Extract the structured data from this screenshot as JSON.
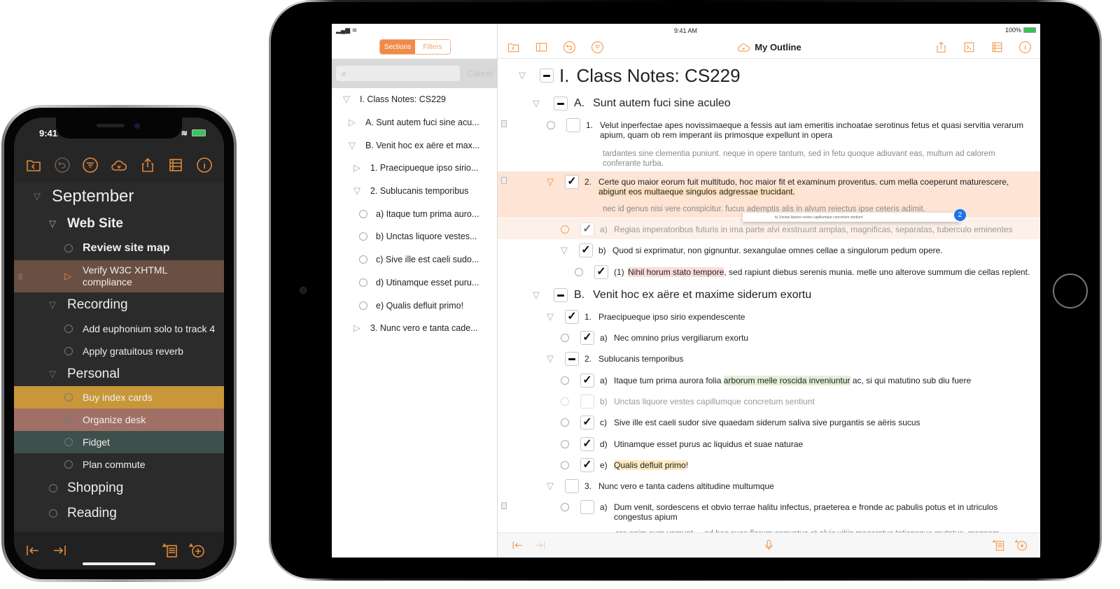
{
  "colors": {
    "accent": "#f08b47",
    "phone_bg": "#2b2b2b",
    "selected_row": "#6a4f43",
    "yellow_row": "#c9973a",
    "rose_row": "#a07066",
    "teal_row": "#3e504c"
  },
  "phone": {
    "status": {
      "time": "9:41",
      "icons": [
        "location-arrow-icon",
        "wifi-icon",
        "battery-icon"
      ]
    },
    "toolbar": [
      "folder-back-icon",
      "undo-icon",
      "filter-icon",
      "sync-cloud-icon",
      "share-icon",
      "columns-icon",
      "info-icon"
    ],
    "outline": [
      {
        "label": "September",
        "level": 0,
        "marker": "triangle-down"
      },
      {
        "label": "Web Site",
        "level": 1,
        "marker": "triangle-down",
        "bold": true
      },
      {
        "label": "Review site map",
        "level": 2,
        "marker": "circle",
        "bold": true
      },
      {
        "label": "Verify W3C XHTML compliance",
        "level": 2,
        "marker": "triangle-right",
        "selected": true
      },
      {
        "label": "Recording",
        "level": 1,
        "marker": "triangle-down"
      },
      {
        "label": "Add euphonium solo to track 4",
        "level": 2,
        "marker": "circle"
      },
      {
        "label": "Apply gratuitous reverb",
        "level": 2,
        "marker": "circle"
      },
      {
        "label": "Personal",
        "level": 1,
        "marker": "triangle-down"
      },
      {
        "label": "Buy index cards",
        "level": 2,
        "marker": "circle",
        "color": "yellow"
      },
      {
        "label": "Organize desk",
        "level": 2,
        "marker": "circle",
        "color": "rose"
      },
      {
        "label": "Fidget",
        "level": 2,
        "marker": "circle",
        "color": "teal"
      },
      {
        "label": "Plan commute",
        "level": 2,
        "marker": "circle"
      },
      {
        "label": "Shopping",
        "level": 1,
        "marker": "circle"
      },
      {
        "label": "Reading",
        "level": 1,
        "marker": "circle"
      }
    ],
    "bottom": [
      "outdent-icon",
      "indent-icon",
      "add-note-icon",
      "add-row-icon"
    ]
  },
  "ipad": {
    "status": {
      "time": "9:41 AM",
      "battery": "100%"
    },
    "sidebar": {
      "tabs": [
        {
          "label": "Sections",
          "active": true
        },
        {
          "label": "Filters",
          "active": false
        }
      ],
      "search_placeholder": "",
      "cancel_label": "Cancel",
      "items": [
        {
          "label": "I.  Class Notes: CS229",
          "marker": "triangle-down",
          "indent": 0
        },
        {
          "label": "A.  Sunt autem fuci sine acu...",
          "marker": "triangle-right",
          "indent": 1
        },
        {
          "label": "B.  Venit hoc ex aëre et max...",
          "marker": "triangle-down",
          "indent": 1
        },
        {
          "label": "1.  Praecipueque ipso sirio...",
          "marker": "triangle-right",
          "indent": 2
        },
        {
          "label": "2.  Sublucanis temporibus",
          "marker": "triangle-down",
          "indent": 2
        },
        {
          "label": "a)  Itaque tum prima auro...",
          "marker": "circle",
          "indent": 3
        },
        {
          "label": "b)  Unctas liquore vestes...",
          "marker": "circle",
          "indent": 3
        },
        {
          "label": "c)  Sive ille est caeli sudo...",
          "marker": "circle",
          "indent": 3
        },
        {
          "label": "d)  Utinamque esset puru...",
          "marker": "circle",
          "indent": 3
        },
        {
          "label": "e)  Qualis defluit primo!",
          "marker": "circle",
          "indent": 3
        },
        {
          "label": "3.  Nunc vero e tanta cade...",
          "marker": "triangle-right",
          "indent": 2
        }
      ]
    },
    "toolbar": {
      "left": [
        "folder-back-icon",
        "sidebar-icon",
        "undo-icon",
        "filter-icon"
      ],
      "title": "My Outline",
      "right": [
        "share-icon",
        "terminal-icon",
        "columns-icon",
        "info-icon"
      ]
    },
    "outline": {
      "title": {
        "num": "I.",
        "text": "Class Notes: CS229"
      },
      "A": {
        "num": "A.",
        "text": "Sunt autem fuci sine aculeo"
      },
      "A1": {
        "num": "1.",
        "text": "Velut inperfectae apes novissimaeque a fessis aut iam emeritis inchoatae serotinus fetus et quasi servitia verarum apium, quam ob rem imperant iis primosque expellunt in opera",
        "note": "tardantes sine clementia puniunt. neque in opere tantum, sed in fetu quoque adiuvant eas, multum ad calorem conferante turba."
      },
      "A2": {
        "num": "2.",
        "text_before": "Certe quo maior eorum fuit multitudo, hoc maior fit et examinum proventus. cum mella coeperunt maturescere, ",
        "text_hl": "abigunt eos multaeque singulos adgressae trucidant.",
        "note": "nec id genus nisi vere conspicitur. fucus ademptis alis in alvum reiectus ipse ceteris adimit."
      },
      "drag_preview": "b)  Unctas liquore vestes capillumque concretum sentiunt",
      "drag_count": "2",
      "A2a": {
        "num": "a)",
        "text": "Regias imperatoribus futuris in ima parte alvi exstruunt amplas, magnificas, separatas, tuberculo eminentes"
      },
      "A2b": {
        "num": "b)",
        "text": "Quod si exprimatur, non gignuntur. sexangulae omnes cellae a singulorum pedum opere."
      },
      "A2b1": {
        "num": "(1)",
        "hl": "Nihil horum stato tempore",
        "rest": ", sed rapiunt diebus serenis munia. melle uno alterove summum die cellas replent."
      },
      "B": {
        "num": "B.",
        "text": "Venit hoc ex aëre et maxime siderum exortu"
      },
      "B1": {
        "num": "1.",
        "text": "Praecipueque ipso sirio expendescente"
      },
      "B1a": {
        "num": "a)",
        "text": "Nec omnino prius vergiliarum exortu"
      },
      "B2": {
        "num": "2.",
        "text": "Sublucanis temporibus"
      },
      "B2a": {
        "num": "a)",
        "before": "Itaque tum prima aurora folia ",
        "hl": "arborum melle roscida inveniuntur",
        "after": " ac, si qui matutino sub diu fuere"
      },
      "B2b": {
        "num": "b)",
        "text": "Unctas liquore vestes capillumque concretum sentiunt"
      },
      "B2c": {
        "num": "c)",
        "text": "Sive ille est caeli sudor sive quaedam siderum saliva sive purgantis se aëris sucus"
      },
      "B2d": {
        "num": "d)",
        "text": "Utinamque esset purus ac liquidus et suae naturae"
      },
      "B2e": {
        "num": "e)",
        "hl": "Qualis defluit primo",
        "after": "!"
      },
      "B3": {
        "num": "3.",
        "text": "Nunc vero e tanta cadens altitudine multumque"
      },
      "B3a": {
        "num": "a)",
        "text": "Dum venit, sordescens et obvio terrae halitu infectus, praeterea e fronde ac pabulis potus et in utriculos congestus apium"
      },
      "B3a_note": "ore enim eum vomunt ... ad hoc suco florum corruptus et alvis vitiis maceratus totiensque mutatus, magnam"
    },
    "bottom": [
      "outdent-icon",
      "indent-icon",
      "microphone-icon",
      "add-note-icon",
      "add-row-icon"
    ]
  }
}
